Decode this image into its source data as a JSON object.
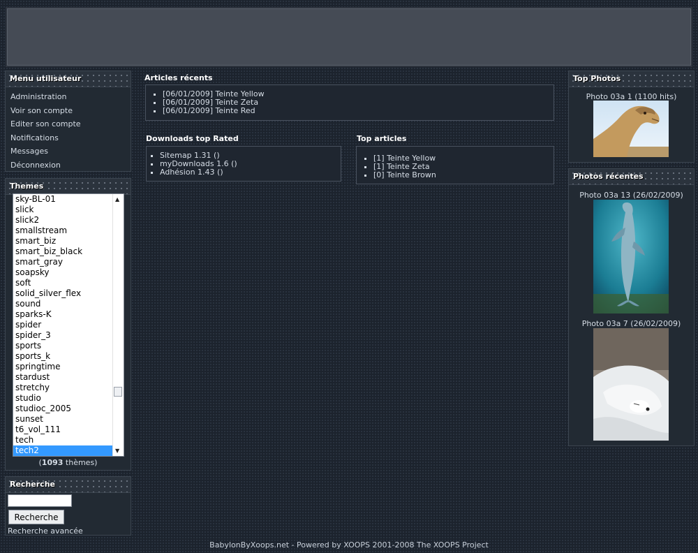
{
  "user_menu": {
    "title": "Menu utilisateur",
    "items": [
      "Administration",
      "Voir son compte",
      "Editer son compte",
      "Notifications",
      "Messages",
      "Déconnexion"
    ]
  },
  "themes": {
    "title": "Themes",
    "options": [
      "sky-BL-01",
      "slick",
      "slick2",
      "smallstream",
      "smart_biz",
      "smart_biz_black",
      "smart_gray",
      "soapsky",
      "soft",
      "solid_silver_flex",
      "sound",
      "sparks-K",
      "spider",
      "spider_3",
      "sports",
      "sports_k",
      "springtime",
      "stardust",
      "stretchy",
      "studio",
      "studioc_2005",
      "sunset",
      "t6_vol_111",
      "tech",
      "tech2"
    ],
    "selected": "tech2",
    "count_prefix": "(",
    "count": "1093",
    "count_suffix": " thèmes)"
  },
  "search": {
    "title": "Recherche",
    "input_value": "",
    "button_label": "Recherche",
    "advanced_link": "Recherche avancée"
  },
  "recent_articles": {
    "title": "Articles récents",
    "items": [
      "[06/01/2009] Teinte Yellow",
      "[06/01/2009] Teinte Zeta",
      "[06/01/2009] Teinte Red"
    ]
  },
  "downloads": {
    "title": "Downloads top Rated",
    "items": [
      "Sitemap 1.31 ()",
      "myDownloads 1.6 ()",
      "Adhésion 1.43 ()"
    ]
  },
  "top_articles": {
    "title": "Top articles",
    "items": [
      "[1] Teinte Yellow",
      "[1] Teinte Zeta",
      "[0] Teinte Brown"
    ]
  },
  "top_photos": {
    "title": "Top Photos",
    "caption": "Photo 03a 1 (1100 hits)"
  },
  "recent_photos": {
    "title": "Photos récentes",
    "captions": [
      "Photo 03a 13 (26/02/2009)",
      "Photo 03a 7 (26/02/2009)"
    ]
  },
  "footer": {
    "text": "BabylonByXoops.net - Powered by XOOPS 2001-2008 The XOOPS Project"
  }
}
